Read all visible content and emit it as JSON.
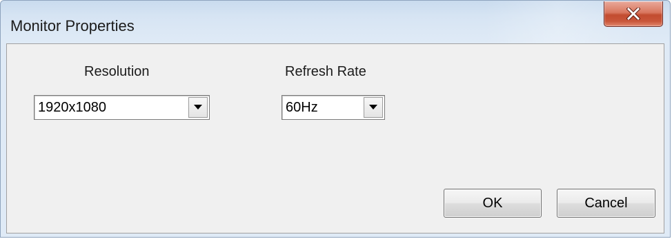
{
  "window": {
    "title": "Monitor Properties"
  },
  "resolution": {
    "label": "Resolution",
    "selected": "1920x1080"
  },
  "refresh_rate": {
    "label": "Refresh Rate",
    "selected": "60Hz"
  },
  "buttons": {
    "ok_label": "OK",
    "cancel_label": "Cancel"
  },
  "icons": {
    "close": "close-icon",
    "dropdown": "chevron-down-icon"
  },
  "colors": {
    "title_bar": "#d6e4f3",
    "client_area": "#f0f0f0",
    "close_button": "#c24c30"
  }
}
